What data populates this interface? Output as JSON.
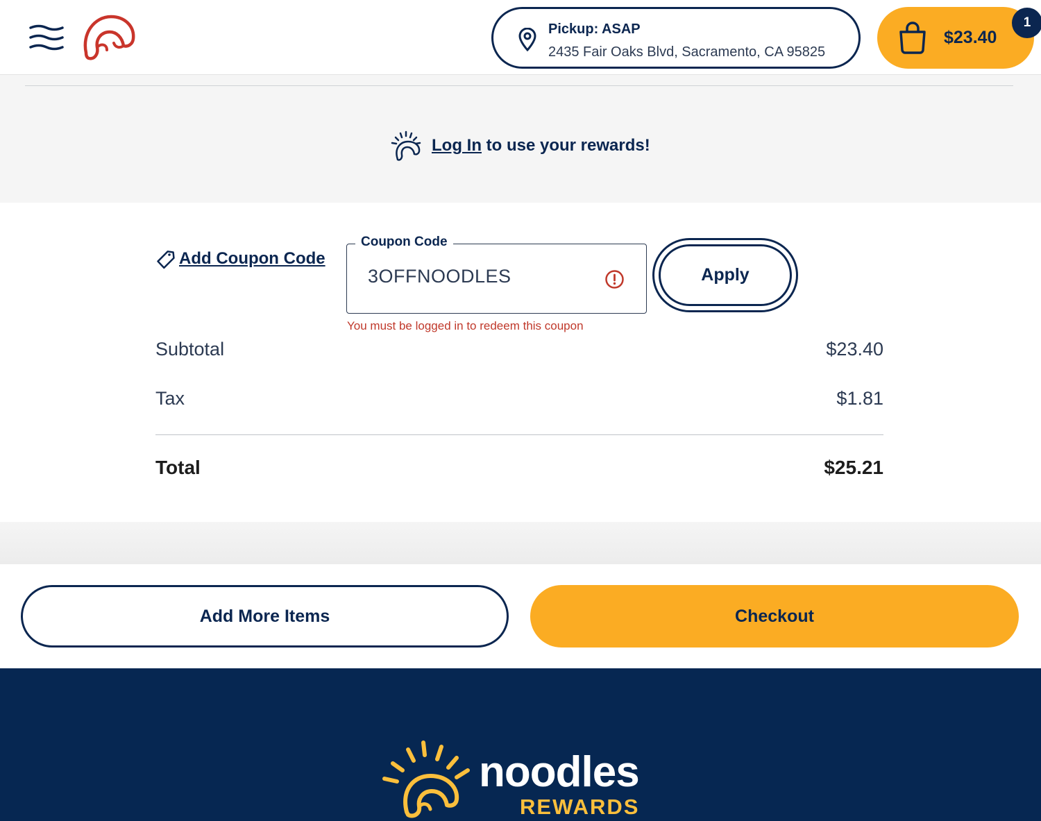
{
  "header": {
    "pickup": {
      "title": "Pickup: ASAP",
      "address": "2435 Fair Oaks Blvd, Sacramento, CA 95825"
    },
    "cart": {
      "amount": "$23.40",
      "count": "1"
    }
  },
  "rewards": {
    "login_link": "Log In",
    "login_text": " to use your rewards!"
  },
  "coupon": {
    "link_label": "Add Coupon Code",
    "field_label": "Coupon Code",
    "value": "3OFFNOODLES",
    "error": "You must be logged in to redeem this coupon",
    "apply_label": "Apply"
  },
  "summary": {
    "subtotal_label": "Subtotal",
    "subtotal_value": "$23.40",
    "tax_label": "Tax",
    "tax_value": "$1.81",
    "total_label": "Total",
    "total_value": "$25.21"
  },
  "actions": {
    "add_more": "Add More Items",
    "checkout": "Checkout"
  },
  "footer": {
    "brand": "noodles",
    "sub": "REWARDS"
  },
  "colors": {
    "navy": "#0b2650",
    "accent": "#fbac23",
    "error": "#c0392b",
    "footer_bg": "#062752",
    "logo_red": "#c9352b"
  }
}
